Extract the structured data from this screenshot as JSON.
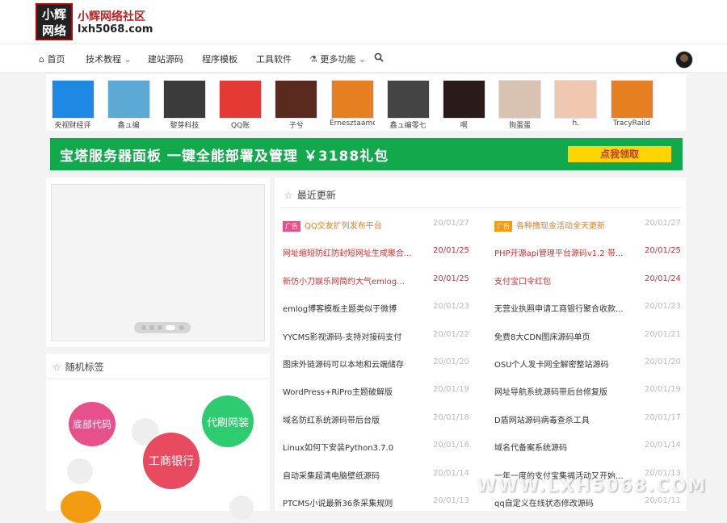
{
  "header": {
    "logo_line1": "小辉",
    "logo_line2": "网络",
    "site_name": "小辉网络社区",
    "site_url": "lxh5068.com"
  },
  "nav": [
    {
      "label": "首页",
      "icon": "home-icon"
    },
    {
      "label": "技术教程",
      "icon": "chevron-down-icon"
    },
    {
      "label": "建站源码"
    },
    {
      "label": "程序模板"
    },
    {
      "label": "工具软件"
    },
    {
      "label": "更多功能",
      "icon": "flask-icon"
    }
  ],
  "users": [
    {
      "name": "央视财经评",
      "color": "#1e88e5"
    },
    {
      "name": "鑫ュ编",
      "color": "#5da9d6"
    },
    {
      "name": "黎芽科技",
      "color": "#3b3b3b"
    },
    {
      "name": "QQ账",
      "color": "#e53935"
    },
    {
      "name": "子兮",
      "color": "#5a2a1e"
    },
    {
      "name": "Ernesztaamomo",
      "color": "#e67e22"
    },
    {
      "name": "鑫ュ编零七",
      "color": "#444"
    },
    {
      "name": "啊",
      "color": "#2b1a1a"
    },
    {
      "name": "狗蛋蛋",
      "color": "#d8c3b3"
    },
    {
      "name": "h.",
      "color": "#f0c8b0"
    },
    {
      "name": "TracyRaild",
      "color": "#e67e22"
    }
  ],
  "banner": {
    "text": "宝塔服务器面板 一键全能部署及管理 ￥3188礼包",
    "button": "点我领取",
    "color": "#12a84c"
  },
  "tags": {
    "title": "随机标签",
    "items": [
      {
        "label": "底部代码",
        "color": "#e8508b"
      },
      {
        "label": "代刷网装",
        "color": "#2ecc71"
      },
      {
        "label": "工商银行",
        "color": "#e84a5f"
      }
    ]
  },
  "news": {
    "title": "最近更新",
    "badge": "广告",
    "left": [
      {
        "title": "QQ交友扩列发布平台",
        "date": "20/01/27",
        "style": "badge"
      },
      {
        "title": "网址缩短防红防封短网址生成聚合...",
        "date": "20/01/25",
        "style": "red"
      },
      {
        "title": "新仿小刀娱乐网简约大气emlog主...",
        "date": "20/01/25",
        "style": "red"
      },
      {
        "title": "emlog博客模板主题类似于微博",
        "date": "20/01/23",
        "style": "dark"
      },
      {
        "title": "YYCMS影视源码-支持对接码支付",
        "date": "20/01/22",
        "style": "dark"
      },
      {
        "title": "图床外链源码可以本地和云端储存",
        "date": "20/01/20",
        "style": "dark"
      },
      {
        "title": "WordPress+RiPro主题破解版",
        "date": "20/01/19",
        "style": "dark"
      },
      {
        "title": "域名防红系统源码带后台版",
        "date": "20/01/18",
        "style": "dark"
      },
      {
        "title": "Linux如何下安装Python3.7.0",
        "date": "20/01/16",
        "style": "dark"
      },
      {
        "title": "自动采集超清电脑壁纸源码",
        "date": "20/01/14",
        "style": "dark"
      },
      {
        "title": "PTCMS小说最新36条采集规则",
        "date": "20/01/13",
        "style": "dark"
      }
    ],
    "right": [
      {
        "title": "各种撸现金活动全天更新",
        "date": "20/01/27",
        "style": "badge"
      },
      {
        "title": "PHP开源api管理平台源码v1.2 带...",
        "date": "20/01/25",
        "style": "red"
      },
      {
        "title": "支付宝口令红包",
        "date": "20/01/24",
        "style": "red"
      },
      {
        "title": "无营业执照申请工商银行聚合收款...",
        "date": "20/01/23",
        "style": "dark"
      },
      {
        "title": "免费8大CDN图床源码单页",
        "date": "20/01/21",
        "style": "dark"
      },
      {
        "title": "OSU个人发卡网全解密整站源码",
        "date": "20/01/20",
        "style": "dark"
      },
      {
        "title": "网址导航系统源码带后台修复版",
        "date": "20/01/19",
        "style": "dark"
      },
      {
        "title": "D盾网站源码病毒查杀工具",
        "date": "20/01/17",
        "style": "dark"
      },
      {
        "title": "域名代备案系统源码",
        "date": "20/01/14",
        "style": "dark"
      },
      {
        "title": "一年一度的支付宝集福活动又开始...",
        "date": "20/01/13",
        "style": "dark"
      },
      {
        "title": "qq自定义在线状态修改源码",
        "date": "20/01/11",
        "style": "dark"
      }
    ]
  },
  "watermark": "WWW.LXH5068.COM"
}
